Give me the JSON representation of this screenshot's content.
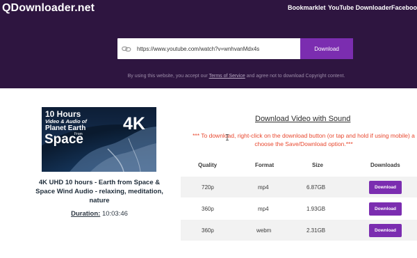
{
  "header": {
    "logo": "QDownloader.net",
    "nav": [
      "Bookmarklet",
      "YouTube Downloader",
      "Facebook"
    ]
  },
  "search": {
    "value": "https://www.youtube.com/watch?v=wnhvanMdx4s",
    "button_label": "Download"
  },
  "terms": {
    "prefix": "By using this website, you accept our ",
    "link": "Terms of Service",
    "suffix": " and agree not to download Copyright content."
  },
  "video": {
    "thumbnail_text": {
      "line1": "10 Hours",
      "line2": "Video & Audio of",
      "line3": "Planet Earth",
      "line4": "From",
      "line5": "Space",
      "badge": "4K"
    },
    "title": "4K UHD 10 hours - Earth from Space & Space Wind Audio - relaxing, meditation, nature",
    "duration_label": "Duration:",
    "duration_value": "10:03:46"
  },
  "downloads": {
    "heading": "Download Video with Sound",
    "note_line1": "*** To download, right-click on the download button (or tap and hold if using mobile) a",
    "note_line2": "choose the Save/Download option.***",
    "columns": [
      "Quality",
      "Format",
      "Size",
      "Downloads"
    ],
    "rows": [
      {
        "quality": "720p",
        "format": "mp4",
        "size": "6.87GB",
        "button": "Download"
      },
      {
        "quality": "360p",
        "format": "mp4",
        "size": "1.93GB",
        "button": "Download"
      },
      {
        "quality": "360p",
        "format": "webm",
        "size": "2.31GB",
        "button": "Download"
      }
    ]
  },
  "colors": {
    "header_bg": "#2e1540",
    "accent": "#7b2db0",
    "note": "#e8472e"
  }
}
